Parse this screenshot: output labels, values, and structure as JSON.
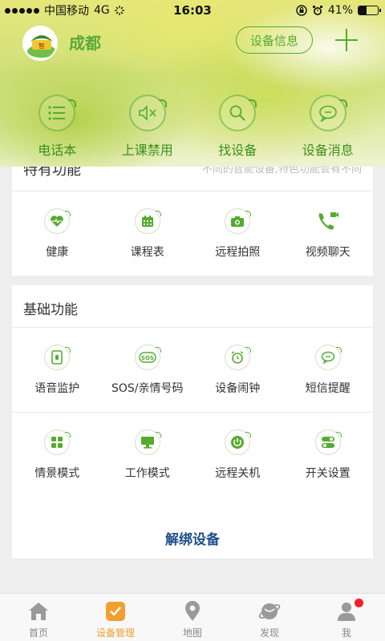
{
  "status_bar": {
    "carrier": "中国移动",
    "network": "4G",
    "time": "16:03",
    "battery": "41%",
    "battery_level": 0.41
  },
  "header": {
    "city": "成都",
    "device_info_label": "设备信息"
  },
  "quick_actions": [
    {
      "label": "电话本",
      "icon": "list-icon"
    },
    {
      "label": "上课禁用",
      "icon": "mute-icon"
    },
    {
      "label": "找设备",
      "icon": "search-icon"
    },
    {
      "label": "设备消息",
      "icon": "chat-bubble-icon"
    }
  ],
  "special": {
    "title": "特有功能",
    "hint": "不同的智能设备,特色功能会有不同",
    "items": [
      {
        "label": "健康",
        "icon": "heart-icon"
      },
      {
        "label": "课程表",
        "icon": "calendar-icon"
      },
      {
        "label": "远程拍照",
        "icon": "camera-icon"
      },
      {
        "label": "视频聊天",
        "icon": "video-call-icon"
      }
    ]
  },
  "basic": {
    "title": "基础功能",
    "rows": [
      [
        {
          "label": "语音监护",
          "icon": "phone-monitor-icon"
        },
        {
          "label": "SOS/亲情号码",
          "icon": "sos-icon"
        },
        {
          "label": "设备闹钟",
          "icon": "alarm-icon"
        },
        {
          "label": "短信提醒",
          "icon": "message-icon"
        }
      ],
      [
        {
          "label": "情景模式",
          "icon": "grid-icon"
        },
        {
          "label": "工作模式",
          "icon": "monitor-icon"
        },
        {
          "label": "远程关机",
          "icon": "power-icon"
        },
        {
          "label": "开关设置",
          "icon": "toggle-icon"
        }
      ]
    ]
  },
  "unbind_label": "解绑设备",
  "tabs": [
    {
      "label": "首页",
      "icon": "home-icon"
    },
    {
      "label": "设备管理",
      "icon": "device-manage-icon",
      "active": true
    },
    {
      "label": "地图",
      "icon": "map-pin-icon"
    },
    {
      "label": "发现",
      "icon": "planet-icon"
    },
    {
      "label": "我",
      "icon": "user-icon"
    }
  ],
  "colors": {
    "accent_green": "#56ab2f",
    "tab_active": "#f0a030",
    "unbind_text": "#1f4f8a",
    "badge_red": "#f0202a"
  }
}
